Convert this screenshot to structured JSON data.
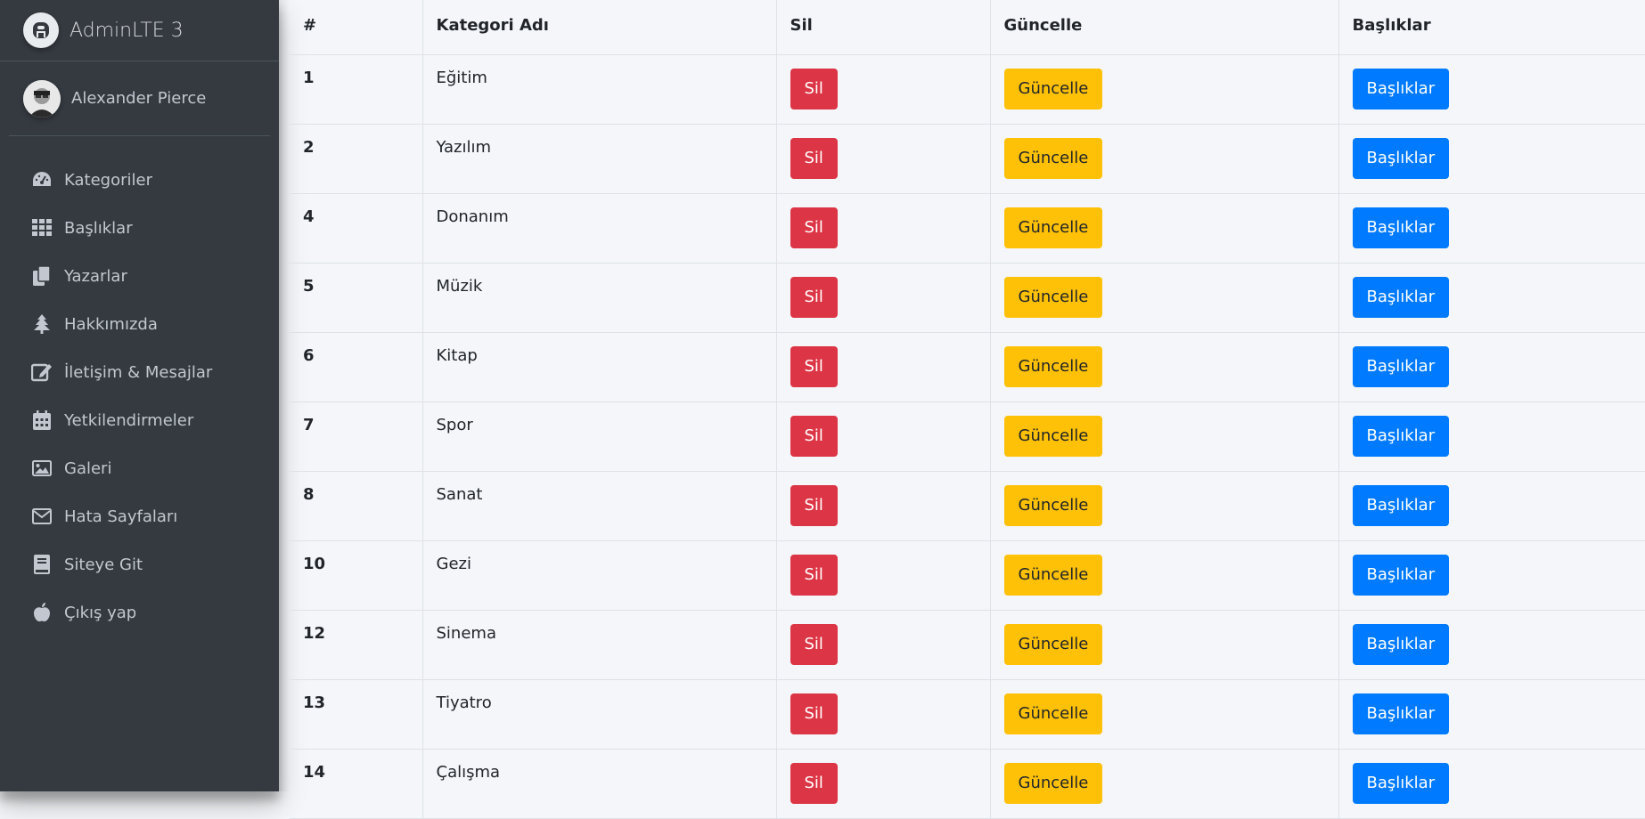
{
  "brand": {
    "title": "AdminLTE 3"
  },
  "user": {
    "name": "Alexander Pierce"
  },
  "sidebar": {
    "items": [
      {
        "label": "Kategoriler",
        "icon": "tachometer-icon"
      },
      {
        "label": "Başlıklar",
        "icon": "grid-icon"
      },
      {
        "label": "Yazarlar",
        "icon": "copy-icon"
      },
      {
        "label": "Hakkımızda",
        "icon": "tree-icon"
      },
      {
        "label": "İletişim & Mesajlar",
        "icon": "edit-icon"
      },
      {
        "label": "Yetkilendirmeler",
        "icon": "calendar-icon"
      },
      {
        "label": "Galeri",
        "icon": "image-icon"
      },
      {
        "label": "Hata Sayfaları",
        "icon": "envelope-icon"
      },
      {
        "label": "Siteye Git",
        "icon": "book-icon"
      },
      {
        "label": "Çıkış yap",
        "icon": "apple-icon"
      }
    ]
  },
  "table": {
    "headers": [
      "#",
      "Kategori Adı",
      "Sil",
      "Güncelle",
      "Başlıklar"
    ],
    "buttons": {
      "sil": "Sil",
      "guncelle": "Güncelle",
      "basliklar": "Başlıklar"
    },
    "rows": [
      {
        "id": "1",
        "name": "Eğitim"
      },
      {
        "id": "2",
        "name": "Yazılım"
      },
      {
        "id": "4",
        "name": "Donanım"
      },
      {
        "id": "5",
        "name": "Müzik"
      },
      {
        "id": "6",
        "name": "Kitap"
      },
      {
        "id": "7",
        "name": "Spor"
      },
      {
        "id": "8",
        "name": "Sanat"
      },
      {
        "id": "10",
        "name": "Gezi"
      },
      {
        "id": "12",
        "name": "Sinema"
      },
      {
        "id": "13",
        "name": "Tiyatro"
      },
      {
        "id": "14",
        "name": "Çalışma"
      }
    ]
  },
  "colors": {
    "sidebar_bg": "#343a40",
    "danger": "#dc3545",
    "warning": "#ffc107",
    "primary": "#007bff"
  }
}
